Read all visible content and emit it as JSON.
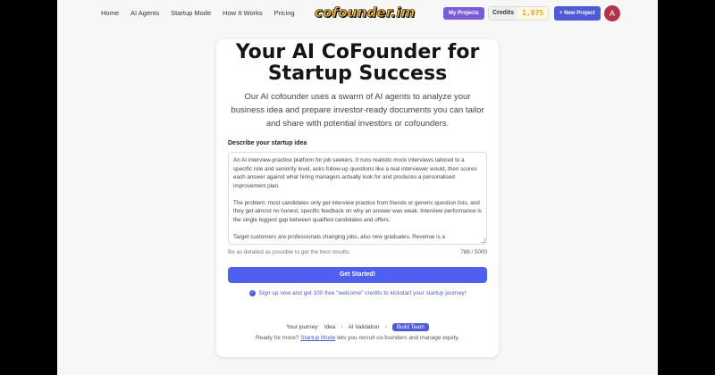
{
  "nav": {
    "links": [
      "Home",
      "AI Agents",
      "Startup Mode",
      "How It Works",
      "Pricing"
    ],
    "logo": "cofounder.im",
    "my_projects": "My Projects",
    "credits_label": "Credits",
    "credits_value": "1,075",
    "new_project": "+ New Project",
    "avatar_initial": "A"
  },
  "hero": {
    "title": "Your AI CoFounder for Startup Success",
    "subtitle": "Our AI cofounder uses a swarm of AI agents to analyze your business idea and prepare investor-ready documents you can tailor and share with potential investors or cofounders."
  },
  "form": {
    "label": "Describe your startup idea",
    "idea_paragraphs": [
      "An AI interview-practice platform for job seekers. It runs realistic mock interviews tailored to a specific role and seniority level, asks follow-up questions like a real interviewer would, then scores each answer against what hiring managers actually look for and produces a personalised improvement plan.",
      "The problem: most candidates only get interview practice from friends or generic question lists, and they get almost no honest, specific feedback on why an answer was weak. Interview performance is the single biggest gap between qualified candidates and offers.",
      "Target customers are professionals changing jobs, also new graduates. Revenue is a"
    ],
    "hint": "Be as detailed as possible to get the best results.",
    "char_count": "788 / 5000",
    "submit": "Get Started!",
    "signup_note": "Sign up now and get 100 free \"welcome\" credits to kickstart your startup journey!"
  },
  "journey": {
    "label": "Your journey:",
    "steps": [
      "Idea",
      "AI Validation",
      "Build Team"
    ],
    "ready_prefix": "Ready for more?",
    "ready_link": "Startup Mode",
    "ready_suffix": "lets you recruit co-founders and manage equity."
  },
  "colors": {
    "accent": "#4f5bd5",
    "projects_button": "#7b5cd6",
    "credits": "#e0a422",
    "avatar": "#b3344a"
  }
}
